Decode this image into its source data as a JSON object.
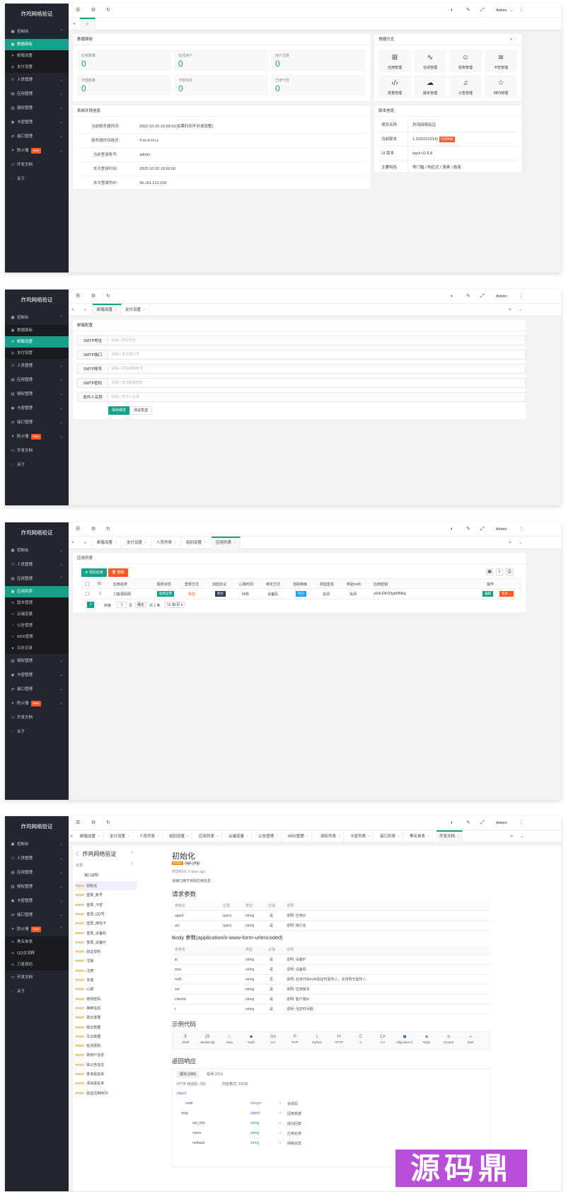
{
  "app_title": "炸鸡网络验证",
  "admin": "Admin",
  "colors": {
    "accent": "#16a089",
    "danger": "#ff5722",
    "sidebar": "#22262e",
    "badge": "#ff5722"
  },
  "icons": [
    "menu-icon",
    "gear-icon",
    "refresh-icon",
    "home-icon",
    "chevron-down-icon",
    "double-chevron-left-icon",
    "double-chevron-right-icon",
    "more-icon",
    "expand-icon",
    "theme-icon",
    "note-icon"
  ],
  "sidebar1": {
    "console": "控制台",
    "sub": [
      "数据面板",
      "邮箱设置",
      "支付设置"
    ],
    "items": [
      "人员管理",
      "应用管理",
      "授权管理",
      "卡密管理",
      "接口管理",
      "防火墙",
      "开发文档",
      "关于"
    ],
    "new_badge": "new"
  },
  "sidebar3": {
    "console": "控制台",
    "staff": "人员管理",
    "apps": "应用管理",
    "sub": [
      "应用列表",
      "版本管理",
      "云端变量",
      "公告管理",
      "MD5管理",
      "日志记录"
    ],
    "items": [
      "授权管理",
      "卡密管理",
      "接口管理",
      "防火墙",
      "开发文档",
      "关于"
    ]
  },
  "sidebar4": {
    "items": [
      "控制台",
      "人员管理",
      "应用管理",
      "授权管理",
      "卡密管理",
      "接口管理"
    ],
    "firewall": "防火墙",
    "sub": [
      "黑名单表",
      "QQ交流群",
      "刀客源码"
    ],
    "docs": "开发文档",
    "about": "关于"
  },
  "dashboard": {
    "data_panel": "数据面板",
    "stats": [
      {
        "label": "应用数量",
        "value": "0"
      },
      {
        "label": "在线用户",
        "value": "0"
      },
      {
        "label": "用户总数",
        "value": "0"
      },
      {
        "label": "代理数量",
        "value": "0"
      },
      {
        "label": "卡密库存",
        "value": "0"
      },
      {
        "label": "已使卡密",
        "value": "0"
      }
    ],
    "quick_title": "快捷方式",
    "quick": [
      {
        "icon": "grid-icon",
        "label": "应用管理"
      },
      {
        "icon": "pulse-icon",
        "label": "在线管理"
      },
      {
        "icon": "user-icon",
        "label": "授权管理"
      },
      {
        "icon": "layers-icon",
        "label": "卡密管理"
      },
      {
        "icon": "code-icon",
        "label": "变量管理"
      },
      {
        "icon": "cloud-upload-icon",
        "label": "版本管理"
      },
      {
        "icon": "bell-icon",
        "label": "公告管理"
      },
      {
        "icon": "star-icon",
        "label": "MD5管理"
      }
    ],
    "env_title": "系统环境信息",
    "env": [
      {
        "k": "当前服务器时间:",
        "v": "2022-10-20 15:58:52(如果时间不对请调整)"
      },
      {
        "k": "服务器时间格式:",
        "v": "Y-m-d H:i:s"
      },
      {
        "k": "当前登录账号:",
        "v": "admin"
      },
      {
        "k": "本次登录时间:",
        "v": "2022-10-20 15:58:50"
      },
      {
        "k": "本次登录的IP:",
        "v": "36.161.210.159"
      }
    ],
    "ver_title": "版本信息",
    "ver": [
      {
        "k": "项目名称",
        "v": "炸鸡网络验证"
      },
      {
        "k": "当前版本",
        "v": "1.3(20221014)",
        "tag": "检测更新"
      },
      {
        "k": "UI 版本",
        "v": "layui-v2.6.8"
      },
      {
        "k": "主要特色",
        "v": "零门槛 / 响应式 / 清爽 / 极简"
      }
    ]
  },
  "mail": {
    "tabs": [
      "邮箱设置",
      "支付设置"
    ],
    "title": "邮箱配置",
    "fields": [
      {
        "label": "SMTP地址",
        "ph": "请输入发信地址"
      },
      {
        "label": "SMTP端口",
        "ph": "请输入发信端口号"
      },
      {
        "label": "SMTP账号",
        "ph": "请输入发信邮箱账号"
      },
      {
        "label": "SMTP密码",
        "ph": "请输入发信邮箱密码"
      },
      {
        "label": "发件人名称",
        "ph": "请输入发件人名称"
      }
    ],
    "save": "保存修改",
    "test": "测试发送"
  },
  "apps": {
    "tabs": [
      "邮箱设置",
      "支付设置",
      "人员列表",
      "组别设置",
      "应用列表"
    ],
    "title": "应用列表",
    "add": "添加应用",
    "delete": "删除",
    "headers": [
      "ID",
      "应用名称",
      "服务状态",
      "登录方式",
      "加密协议",
      "心跳时间",
      "绑定方式",
      "自助换绑",
      "校验签名",
      "校验md5",
      "应用密钥",
      "操作"
    ],
    "row": {
      "id": "1",
      "name": "刀客源码网",
      "status": "收费运营",
      "login": "账密",
      "crypto": "明文",
      "heartbeat": "60秒",
      "bind": "设备码",
      "rebind": "开启",
      "sign": "关闭",
      "md5": "关闭",
      "key": "yk66J9K6f3gdMMbq",
      "edit": "编辑",
      "more": "更多"
    },
    "pager": {
      "page": "1",
      "goto": "到第",
      "unit": "页",
      "confirm": "确定",
      "total": "共 1 条",
      "per": "10 条/页"
    }
  },
  "docs": {
    "tabs": [
      "邮箱设置",
      "支付设置",
      "人员列表",
      "组别设置",
      "应用列表",
      "云端变量",
      "公告管理",
      "MD5管理",
      "授权列表",
      "卡密列表",
      "接口列表",
      "黑名单表",
      "开发文档"
    ],
    "brand": "炸鸡网络验证",
    "dir": "目录",
    "intro": "接口说明",
    "apis": [
      "初始化",
      "登录_账号",
      "登录_卡密",
      "登录_QQ号",
      "登录_微信卡",
      "登录_设备码",
      "登录_设备IP",
      "验证授权",
      "注销",
      "注册",
      "充值",
      "心跳",
      "修改密码",
      "换绑信息",
      "取云变量",
      "取云数据",
      "写云数据",
      "检测更新",
      "取用户信息",
      "取公告信息",
      "查询黑名单",
      "添加黑名单",
      "验证应用MD5"
    ],
    "method": "POST",
    "title": "初始化",
    "path": "/api.php",
    "modified": "修改时间: 6 days ago",
    "desc": "该接口用于获取应用信息",
    "req_title": "请求参数",
    "req_head": [
      "参数名",
      "位置",
      "类型",
      "必填",
      "说明"
    ],
    "req_rows": [
      [
        "appid",
        "query",
        "string",
        "是",
        "说明: 应用id"
      ],
      [
        "act",
        "query",
        "string",
        "是",
        "说明: 接口名"
      ]
    ],
    "body_title": "Body 参数(application/x-www-form-urlencoded)",
    "body_head": [
      "参数名",
      "类型",
      "必填",
      "说明"
    ],
    "body_rows": [
      [
        "ip",
        "string",
        "是",
        "说明: 设备IP"
      ],
      [
        "mac",
        "string",
        "是",
        "说明: 设备码"
      ],
      [
        "md5",
        "string",
        "否",
        "说明: 应用开启md5验证时需传入，关闭则无需传入"
      ],
      [
        "ver",
        "string",
        "是",
        "说明: 应用版本"
      ],
      [
        "clientid",
        "string",
        "是",
        "说明: 客户端id"
      ],
      [
        "t",
        "string",
        "是",
        "说明: 当前时间戳"
      ]
    ],
    "code_title": "示例代码",
    "langs": [
      "Shell",
      "JavaScript",
      "Java",
      "Swift",
      "Go",
      "PHP",
      "Python",
      "HTTP",
      "C",
      "C#",
      "Objective-C",
      "Ruby",
      "OCaml",
      "Dart"
    ],
    "resp_title": "返回响应",
    "resp_tabs": [
      "成功 (200)",
      "错误 (201)"
    ],
    "http_code": "HTTP 状态码: 200",
    "content_type": "内容格式: JSON",
    "tree": [
      [
        "object",
        "",
        ""
      ],
      [
        "code",
        "integer",
        "状态码"
      ],
      [
        "msg",
        "object",
        "回复数据"
      ],
      [
        "net_info",
        "string",
        "成功回复"
      ],
      [
        "name",
        "string",
        "应用名称"
      ],
      [
        "notback",
        "string",
        "网络状态"
      ]
    ]
  },
  "watermark": "源码鼎"
}
